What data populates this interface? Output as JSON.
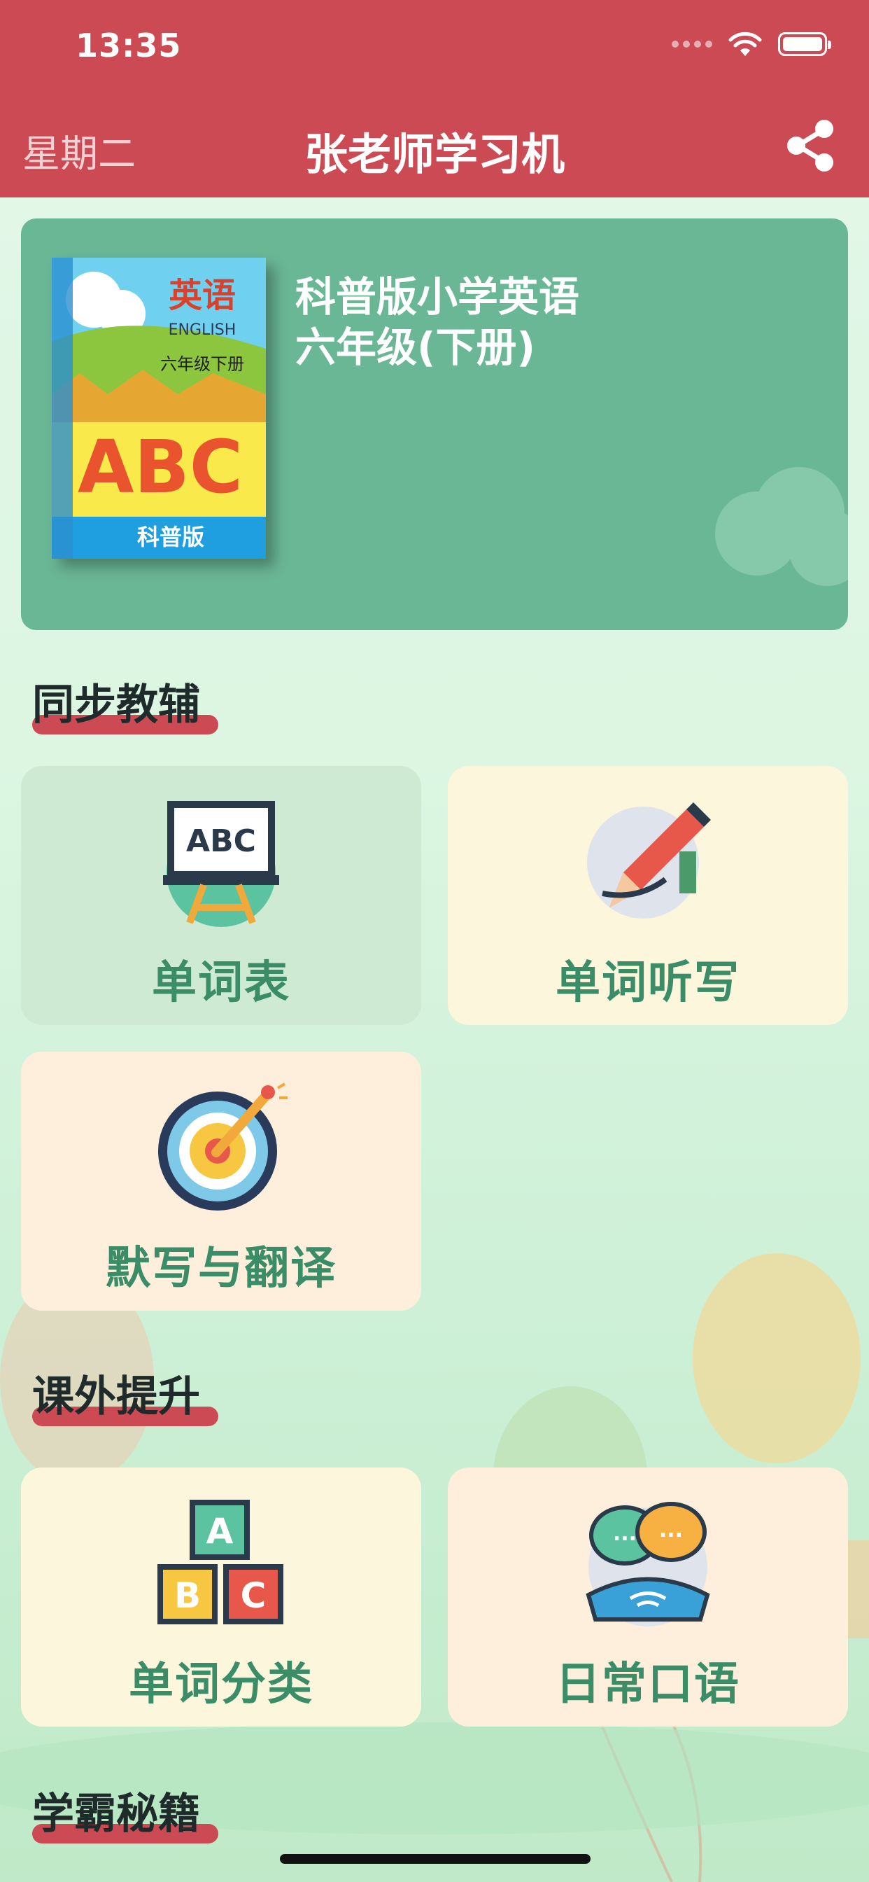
{
  "status_bar": {
    "time": "13:35"
  },
  "header": {
    "weekday": "星期二",
    "title": "张老师学习机"
  },
  "book": {
    "cover": {
      "subject": "英语",
      "english": "ENGLISH",
      "grade": "六年级下册",
      "letters": "ABC",
      "publisher": "科普版"
    },
    "title_line1": "科普版小学英语",
    "title_line2": "六年级(下册)"
  },
  "sections": [
    {
      "title": "同步教辅",
      "tiles": [
        {
          "label": "单词表",
          "icon": "chalkboard-abc-icon",
          "color": "#cfead3"
        },
        {
          "label": "单词听写",
          "icon": "pencil-writing-icon",
          "color": "#fbf6dc"
        },
        {
          "label": "默写与翻译",
          "icon": "target-dart-icon",
          "color": "#fdefdc"
        }
      ]
    },
    {
      "title": "课外提升",
      "tiles": [
        {
          "label": "单词分类",
          "icon": "abc-blocks-icon",
          "color": "#fbf6dc"
        },
        {
          "label": "日常口语",
          "icon": "chat-phone-icon",
          "color": "#fdefdc"
        }
      ]
    },
    {
      "title": "学霸秘籍",
      "tiles": []
    }
  ],
  "colors": {
    "header": "#cc4a53",
    "card": "#6ab795",
    "label": "#3a8d67"
  }
}
